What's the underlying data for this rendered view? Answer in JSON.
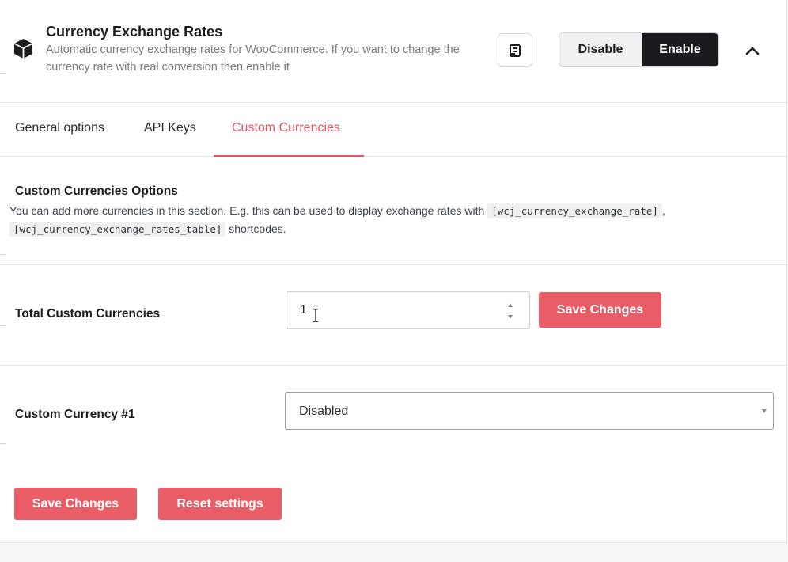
{
  "module": {
    "title": "Currency Exchange Rates",
    "description": "Automatic currency exchange rates for WooCommerce. If you want to change the currency rate with real conversion then enable it",
    "disable_label": "Disable",
    "enable_label": "Enable",
    "state": "enabled"
  },
  "tabs": [
    {
      "label": "General options",
      "active": false
    },
    {
      "label": "API Keys",
      "active": false
    },
    {
      "label": "Custom Currencies",
      "active": true
    }
  ],
  "section": {
    "title": "Custom Currencies Options",
    "desc_prefix": "You can add more currencies in this section. E.g. this can be used to display exchange rates with",
    "code1": "[wcj_currency_exchange_rate]",
    "sep": ",",
    "code2": "[wcj_currency_exchange_rates_table]",
    "desc_suffix": "shortcodes."
  },
  "total_field": {
    "label": "Total Custom Currencies",
    "value": "1",
    "save_label": "Save Changes"
  },
  "currency_field": {
    "label": "Custom Currency #1",
    "selected": "Disabled"
  },
  "footer": {
    "save_label": "Save Changes",
    "reset_label": "Reset settings"
  },
  "colors": {
    "accent": "#e85d66",
    "active_tab": "#e0555f",
    "enable_bg": "#1a1b1f"
  },
  "icons": [
    "cube-icon",
    "document-icon",
    "chevron-up-icon",
    "spinner-arrows-icon",
    "text-cursor-icon",
    "dropdown-arrow-icon"
  ]
}
